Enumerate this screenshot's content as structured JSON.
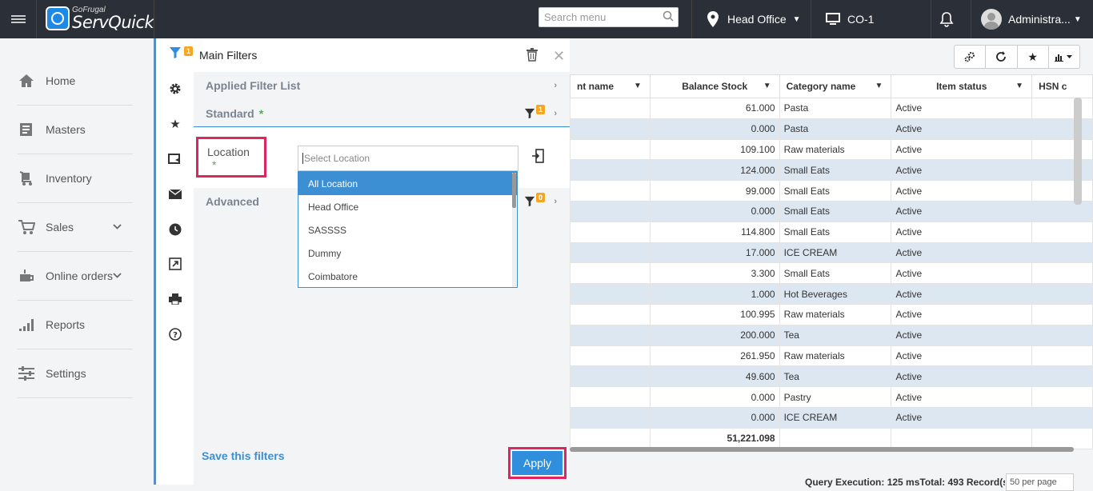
{
  "topbar": {
    "logo_small": "GoFrugal",
    "logo_big": "ServQuick",
    "search_placeholder": "Search menu",
    "location": "Head Office",
    "counter": "CO-1",
    "user": "Administra..."
  },
  "sidebar": {
    "items": [
      {
        "label": "Home",
        "icon": "home-icon"
      },
      {
        "label": "Masters",
        "icon": "masters-icon"
      },
      {
        "label": "Inventory",
        "icon": "inventory-icon"
      },
      {
        "label": "Sales",
        "icon": "cart-icon"
      },
      {
        "label": "Online orders",
        "icon": "online-orders-icon"
      },
      {
        "label": "Reports",
        "icon": "reports-icon"
      },
      {
        "label": "Settings",
        "icon": "settings-icon"
      }
    ]
  },
  "iconstrip": {
    "filter_badge": "1"
  },
  "filters": {
    "title": "Main Filters",
    "applied_filter_list": "Applied Filter List",
    "standard": "Standard",
    "standard_badge": "1",
    "required_mark": "*",
    "location_label": "Location",
    "select_placeholder": "Select Location",
    "options": [
      "All Location",
      "Head Office",
      "SASSSS",
      "Dummy",
      "Coimbatore"
    ],
    "advanced": "Advanced",
    "advanced_badge": "0",
    "save_label": "Save this filters",
    "apply_label": "Apply"
  },
  "grid": {
    "headers": [
      "nt name",
      "Balance Stock",
      "Category name",
      "Item status",
      "HSN c"
    ],
    "rows": [
      [
        "",
        "61.000",
        "Pasta",
        "Active",
        ""
      ],
      [
        "",
        "0.000",
        "Pasta",
        "Active",
        ""
      ],
      [
        "",
        "109.100",
        "Raw materials",
        "Active",
        ""
      ],
      [
        "",
        "124.000",
        "Small Eats",
        "Active",
        ""
      ],
      [
        "",
        "99.000",
        "Small Eats",
        "Active",
        ""
      ],
      [
        "",
        "0.000",
        "Small Eats",
        "Active",
        ""
      ],
      [
        "",
        "114.800",
        "Small Eats",
        "Active",
        ""
      ],
      [
        "",
        "17.000",
        "ICE CREAM",
        "Active",
        ""
      ],
      [
        "",
        "3.300",
        "Small Eats",
        "Active",
        ""
      ],
      [
        "",
        "1.000",
        "Hot Beverages",
        "Active",
        ""
      ],
      [
        "",
        "100.995",
        "Raw materials",
        "Active",
        ""
      ],
      [
        "",
        "200.000",
        "Tea",
        "Active",
        ""
      ],
      [
        "",
        "261.950",
        "Raw materials",
        "Active",
        ""
      ],
      [
        "",
        "49.600",
        "Tea",
        "Active",
        ""
      ],
      [
        "",
        "0.000",
        "Pastry",
        "Active",
        ""
      ],
      [
        "",
        "0.000",
        "ICE CREAM",
        "Active",
        ""
      ]
    ],
    "total": "51,221.098",
    "footer": "Query Execution: 125 msTotal: 493 Record(s)",
    "per_page": "50 per page"
  }
}
